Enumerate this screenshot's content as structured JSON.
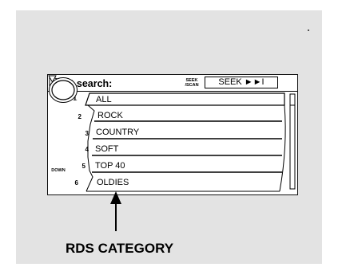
{
  "screen": {
    "title": "RDS search:",
    "seek_scan_top": "SEEK",
    "seek_scan_bottom": "/SCAN",
    "seek_button_label": "SEEK ►►I",
    "down_label": "DOWN"
  },
  "categories": [
    {
      "number": "1",
      "label": "ALL",
      "selected": true
    },
    {
      "number": "2",
      "label": "ROCK"
    },
    {
      "number": "3",
      "label": "COUNTRY"
    },
    {
      "number": "4",
      "label": "SOFT"
    },
    {
      "number": "5",
      "label": "TOP 40"
    },
    {
      "number": "6",
      "label": "OLDIES"
    }
  ],
  "callout": {
    "label": "RDS CATEGORY"
  }
}
